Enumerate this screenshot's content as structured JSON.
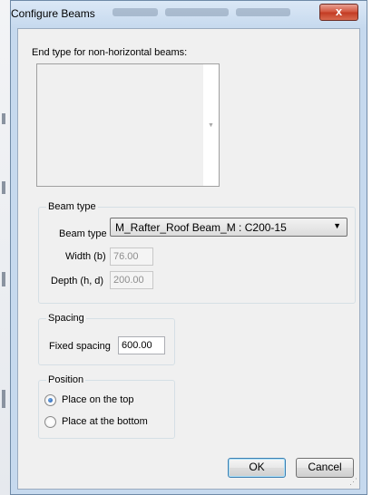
{
  "window": {
    "title": "Configure Beams",
    "close_label": "x"
  },
  "end_type": {
    "label": "End type for non-horizontal beams:"
  },
  "beam_type_group": {
    "legend": "Beam type",
    "type_label": "Beam type",
    "type_value": "M_Rafter_Roof Beam_M : C200-15",
    "width_label": "Width (b)",
    "width_value": "76.00",
    "depth_label": "Depth (h, d)",
    "depth_value": "200.00"
  },
  "spacing_group": {
    "legend": "Spacing",
    "fixed_label": "Fixed spacing",
    "fixed_value": "600.00"
  },
  "position_group": {
    "legend": "Position",
    "options": [
      {
        "label": "Place on the top",
        "selected": true
      },
      {
        "label": "Place at the bottom",
        "selected": false
      }
    ]
  },
  "buttons": {
    "ok": "OK",
    "cancel": "Cancel"
  }
}
